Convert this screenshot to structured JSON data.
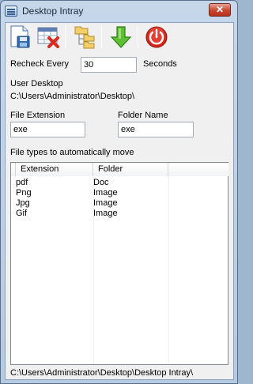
{
  "window": {
    "title": "Desktop Intray",
    "close_glyph": "✕"
  },
  "toolbar": {
    "buttons": [
      {
        "name": "save",
        "icon": "save-icon"
      },
      {
        "name": "clear",
        "icon": "clear-table-icon"
      },
      {
        "name": "folders",
        "icon": "folder-tree-icon"
      },
      {
        "name": "move",
        "icon": "green-down-arrow-icon"
      },
      {
        "name": "exit",
        "icon": "power-icon"
      }
    ]
  },
  "recheck": {
    "label": "Recheck Every",
    "value": "30",
    "unit": "Seconds"
  },
  "user_desktop": {
    "label": "User Desktop",
    "path": "C:\\Users\\Administrator\\Desktop\\"
  },
  "file_extension": {
    "label": "File Extension",
    "value": "exe"
  },
  "folder_name": {
    "label": "Folder Name",
    "value": "exe"
  },
  "file_types": {
    "label": "File types to automatically move",
    "columns": [
      "Extension",
      "Folder"
    ],
    "rows": [
      [
        "pdf",
        "Doc"
      ],
      [
        "Png",
        "Image"
      ],
      [
        "Jpg",
        "Image"
      ],
      [
        "Gif",
        "Image"
      ]
    ]
  },
  "status_path": "C:\\Users\\Administrator\\Desktop\\Desktop Intray\\"
}
